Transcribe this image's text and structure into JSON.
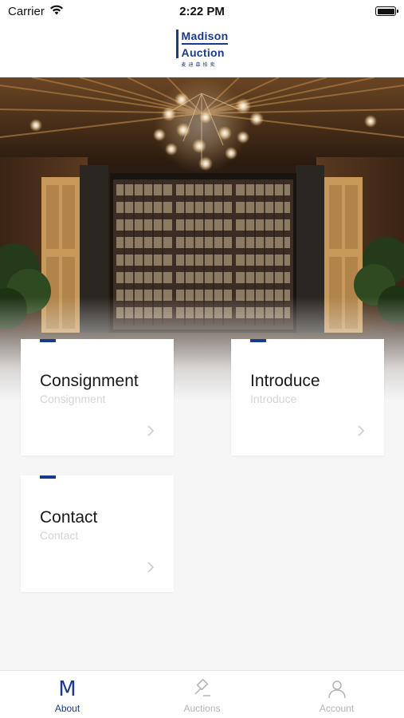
{
  "status_bar": {
    "carrier": "Carrier",
    "time": "2:22 PM"
  },
  "logo": {
    "line1": "Madison",
    "line2": "Auction",
    "sub": "麦迪森拍卖"
  },
  "hero": {
    "icon": "wine-cellar-photo"
  },
  "cards": [
    {
      "title": "Consignment",
      "subtitle": "Consignment"
    },
    {
      "title": "Introduce",
      "subtitle": "Introduce"
    },
    {
      "title": "Contact",
      "subtitle": "Contact"
    }
  ],
  "tab_bar": {
    "tabs": [
      {
        "label": "About",
        "icon": "m-logo-icon",
        "active": true
      },
      {
        "label": "Auctions",
        "icon": "gavel-icon",
        "active": false
      },
      {
        "label": "Account",
        "icon": "person-icon",
        "active": false
      }
    ]
  },
  "colors": {
    "brand": "#1a3a8f",
    "inactive": "#b3b3b6",
    "background": "#f6f6f7"
  }
}
